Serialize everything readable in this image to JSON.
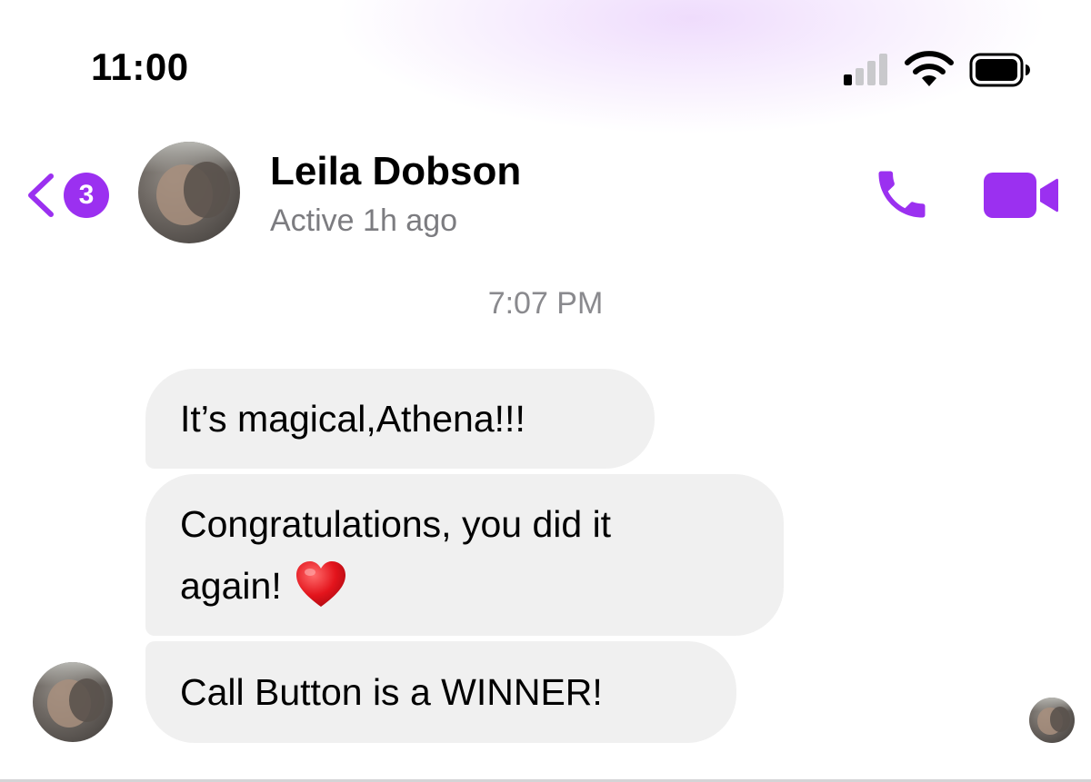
{
  "status_bar": {
    "time": "11:00",
    "signal_icon": "cellular-signal-icon",
    "wifi_icon": "wifi-icon",
    "battery_icon": "battery-icon"
  },
  "header": {
    "back_icon": "chevron-left-icon",
    "unread_count": "3",
    "contact_name": "Leila Dobson",
    "contact_status": "Active 1h ago",
    "call_icon": "phone-icon",
    "video_icon": "video-camera-icon",
    "accent_color": "#9b30f0"
  },
  "conversation": {
    "timestamp": "7:07 PM",
    "messages": [
      {
        "text": "It’s magical,Athena!!!"
      },
      {
        "text": "Congratulations, you did it",
        "text_line2": "again!",
        "emoji": "heart-emoji"
      },
      {
        "text": "Call Button is a WINNER!"
      }
    ],
    "bubble_color": "#f0f0f0"
  }
}
